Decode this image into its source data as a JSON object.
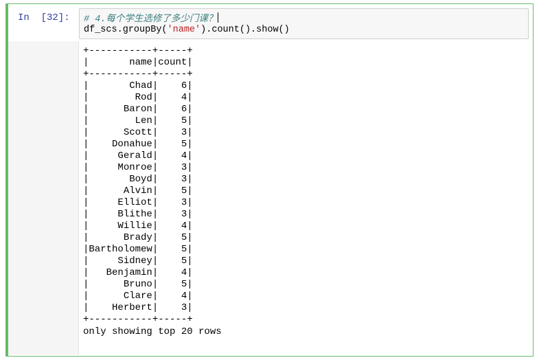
{
  "cell": {
    "prompt": "In  [32]:",
    "code": {
      "comment": "# 4.每个学生选修了多少门课？",
      "line2_prefix": "df_scs.groupBy(",
      "line2_string": "'name'",
      "line2_suffix": ").count().show()"
    }
  },
  "output": {
    "border": "+-----------+-----+",
    "header_name": "name",
    "header_count": "count",
    "rows": [
      {
        "name": "Chad",
        "count": "6"
      },
      {
        "name": "Rod",
        "count": "4"
      },
      {
        "name": "Baron",
        "count": "6"
      },
      {
        "name": "Len",
        "count": "5"
      },
      {
        "name": "Scott",
        "count": "3"
      },
      {
        "name": "Donahue",
        "count": "5"
      },
      {
        "name": "Gerald",
        "count": "4"
      },
      {
        "name": "Monroe",
        "count": "3"
      },
      {
        "name": "Boyd",
        "count": "3"
      },
      {
        "name": "Alvin",
        "count": "5"
      },
      {
        "name": "Elliot",
        "count": "3"
      },
      {
        "name": "Blithe",
        "count": "3"
      },
      {
        "name": "Willie",
        "count": "4"
      },
      {
        "name": "Brady",
        "count": "5"
      },
      {
        "name": "Bartholomew",
        "count": "5"
      },
      {
        "name": "Sidney",
        "count": "5"
      },
      {
        "name": "Benjamin",
        "count": "4"
      },
      {
        "name": "Bruno",
        "count": "5"
      },
      {
        "name": "Clare",
        "count": "4"
      },
      {
        "name": "Herbert",
        "count": "3"
      }
    ],
    "footer": "only showing top 20 rows"
  }
}
